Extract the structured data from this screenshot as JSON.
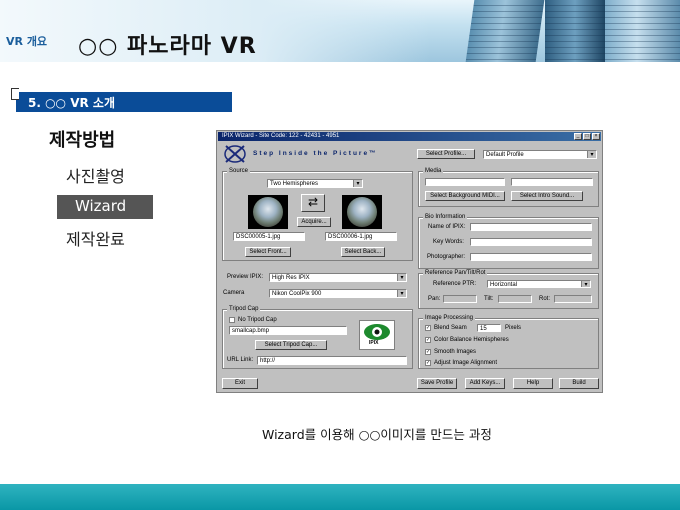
{
  "header": {
    "small_label": "VR 개요",
    "title": "○○ 파노라마 VR"
  },
  "section": {
    "label": "5. ○○ VR 소개"
  },
  "outline": {
    "level1": "제작방법",
    "items": [
      "사진촬영",
      "Wizard",
      "제작완료"
    ],
    "selected_index": 1
  },
  "wizard": {
    "title": "IPIX Wizard - Site Code: 122 - 42431 - 4951",
    "tagline": "Step Inside the Picture™",
    "select_profile_label": "Select Profile...",
    "profile_value": "Default Profile",
    "source": {
      "group_label": "Source",
      "mode_value": "Two Hemispheres",
      "acquire_label": "Acquire...",
      "front_file": "DSC00005-1.jpg",
      "back_file": "DSC00006-1.jpg",
      "select_front_label": "Select Front...",
      "select_back_label": "Select Back..."
    },
    "preview": {
      "label": "Preview IPIX:",
      "value": "High Res IPIX"
    },
    "camera": {
      "label": "Camera",
      "value": "Nikon CoolPix 900"
    },
    "tripod": {
      "group_label": "Tripod Cap",
      "no_tripod_label": "No Tripod Cap",
      "file_value": "smallcap.bmp",
      "select_label": "Select Tripod Cap...",
      "badge_text": "IPIX"
    },
    "url": {
      "label": "URL Link:",
      "value": "http://"
    },
    "media": {
      "group_label": "Media",
      "bg_midi_label": "Select Background MIDI...",
      "intro_sound_label": "Select Intro Sound..."
    },
    "bio": {
      "group_label": "Bio Information",
      "name_label": "Name of IPIX:",
      "keywords_label": "Key Words:",
      "photographer_label": "Photographer:"
    },
    "reference": {
      "group_label": "Reference Pan/Tilt/Rot",
      "ptr_label": "Reference PTR:",
      "ptr_value": "Horizontal",
      "pan_label": "Pan:",
      "tilt_label": "Tilt:",
      "rot_label": "Rot:"
    },
    "image_processing": {
      "group_label": "Image Processing",
      "blend_label": "Blend Seam",
      "blend_value": "15",
      "pixels_label": "Pixels",
      "color_balance_label": "Color Balance Hemispheres",
      "smooth_label": "Smooth Images",
      "adjust_label": "Adjust Image Alignment"
    },
    "buttons": {
      "exit": "Exit",
      "save_profile": "Save Profile",
      "add_keys": "Add Keys...",
      "help": "Help",
      "build": "Build"
    }
  },
  "caption": "Wizard를 이용해 ○○이미지를 만드는 과정",
  "colors": {
    "section_bar": "#0a4c98",
    "footer": "#0a97a6",
    "title_bar": "#0a246a"
  }
}
